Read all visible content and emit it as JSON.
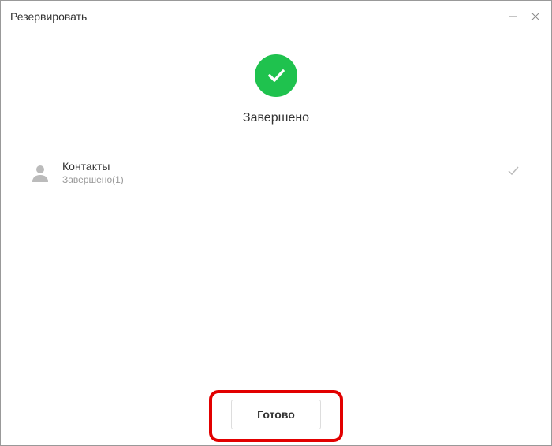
{
  "window": {
    "title": "Резервировать"
  },
  "status": {
    "text": "Завершено"
  },
  "item": {
    "title": "Контакты",
    "subtitle": "Завершено(1)"
  },
  "footer": {
    "done_label": "Готово"
  },
  "colors": {
    "success": "#1fc24e",
    "highlight": "#e20000"
  }
}
